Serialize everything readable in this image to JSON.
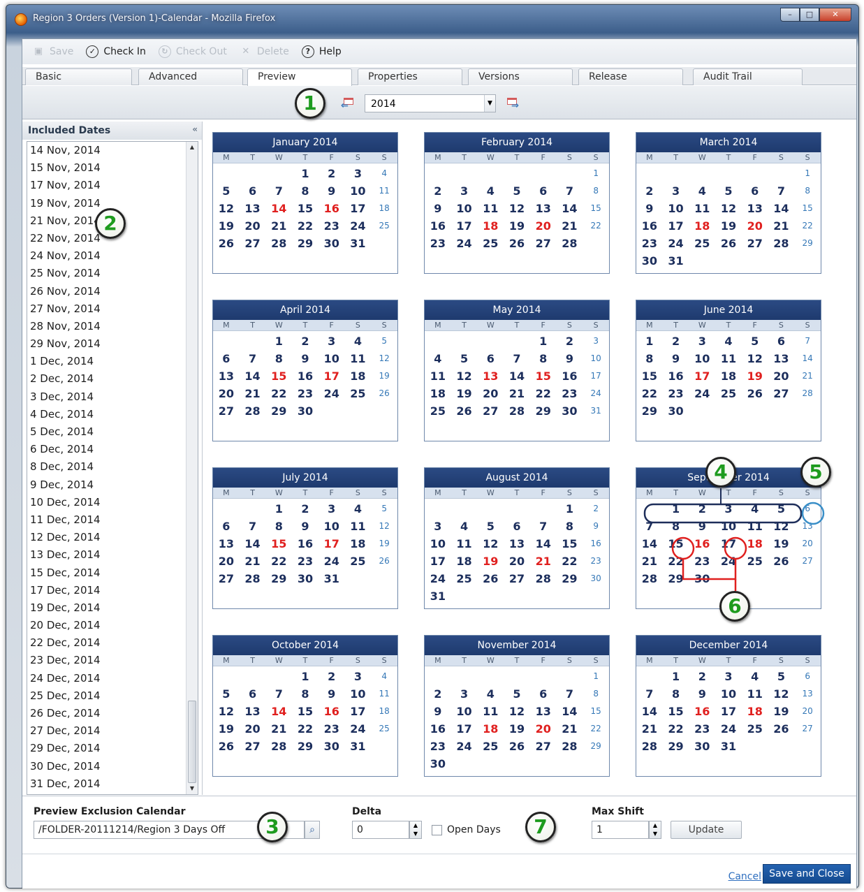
{
  "window": {
    "title": "Region 3 Orders (Version 1)-Calendar - Mozilla Firefox"
  },
  "toolbar": {
    "save": "Save",
    "check_in": "Check In",
    "check_out": "Check Out",
    "delete": "Delete",
    "help": "Help"
  },
  "tabs": [
    "Basic",
    "Advanced",
    "Preview",
    "Properties",
    "Versions",
    "Release",
    "Audit Trail"
  ],
  "active_tab": "Preview",
  "year_selector": {
    "value": "2014"
  },
  "included_dates": {
    "title": "Included Dates",
    "items": [
      "14 Nov, 2014",
      "15 Nov, 2014",
      "17 Nov, 2014",
      "19 Nov, 2014",
      "21 Nov, 2014",
      "22 Nov, 2014",
      "24 Nov, 2014",
      "25 Nov, 2014",
      "26 Nov, 2014",
      "27 Nov, 2014",
      "28 Nov, 2014",
      "29 Nov, 2014",
      "1 Dec, 2014",
      "2 Dec, 2014",
      "3 Dec, 2014",
      "4 Dec, 2014",
      "5 Dec, 2014",
      "6 Dec, 2014",
      "8 Dec, 2014",
      "9 Dec, 2014",
      "10 Dec, 2014",
      "11 Dec, 2014",
      "12 Dec, 2014",
      "13 Dec, 2014",
      "15 Dec, 2014",
      "17 Dec, 2014",
      "19 Dec, 2014",
      "20 Dec, 2014",
      "22 Dec, 2014",
      "23 Dec, 2014",
      "24 Dec, 2014",
      "25 Dec, 2014",
      "26 Dec, 2014",
      "27 Dec, 2014",
      "29 Dec, 2014",
      "30 Dec, 2014",
      "31 Dec, 2014"
    ]
  },
  "weekdays": [
    "M",
    "T",
    "W",
    "T",
    "F",
    "S",
    "S"
  ],
  "months": [
    {
      "name": "January 2014",
      "start": 3,
      "days": 31,
      "red": [
        14,
        16
      ]
    },
    {
      "name": "February 2014",
      "start": 6,
      "days": 28,
      "red": [
        18,
        20
      ]
    },
    {
      "name": "March 2014",
      "start": 6,
      "days": 31,
      "red": [
        18,
        20
      ]
    },
    {
      "name": "April 2014",
      "start": 2,
      "days": 30,
      "red": [
        15,
        17
      ]
    },
    {
      "name": "May 2014",
      "start": 4,
      "days": 31,
      "red": [
        13,
        15
      ]
    },
    {
      "name": "June 2014",
      "start": 0,
      "days": 30,
      "red": [
        17,
        19
      ]
    },
    {
      "name": "July 2014",
      "start": 2,
      "days": 31,
      "red": [
        15,
        17
      ]
    },
    {
      "name": "August 2014",
      "start": 5,
      "days": 31,
      "red": [
        19,
        21
      ]
    },
    {
      "name": "September 2014",
      "start": 1,
      "days": 30,
      "red": [
        16,
        18
      ]
    },
    {
      "name": "October 2014",
      "start": 3,
      "days": 31,
      "red": [
        14,
        16
      ]
    },
    {
      "name": "November 2014",
      "start": 6,
      "days": 30,
      "red": [
        18,
        20
      ]
    },
    {
      "name": "December 2014",
      "start": 1,
      "days": 31,
      "red": [
        16,
        18
      ]
    }
  ],
  "callouts": [
    "1",
    "2",
    "3",
    "4",
    "5",
    "6",
    "7"
  ],
  "bottom": {
    "exclusion_label": "Preview Exclusion Calendar",
    "exclusion_value": "/FOLDER-20111214/Region 3 Days Off",
    "delta_label": "Delta",
    "delta_value": "0",
    "open_days_label": "Open Days",
    "max_shift_label": "Max Shift",
    "max_shift_value": "1",
    "update_label": "Update"
  },
  "footer": {
    "cancel": "Cancel",
    "save_close": "Save and Close"
  }
}
